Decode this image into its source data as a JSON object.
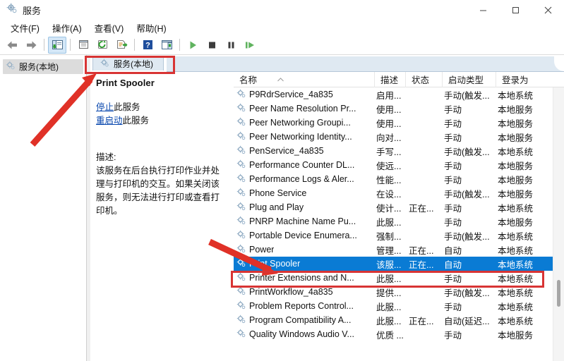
{
  "window": {
    "title": "服务",
    "icon": "services-gear-icon",
    "minimize_label": "—",
    "maximize_label": "▢",
    "close_label": "✕"
  },
  "menu": {
    "items": [
      {
        "label": "文件(F)",
        "name": "menu-file"
      },
      {
        "label": "操作(A)",
        "name": "menu-action"
      },
      {
        "label": "查看(V)",
        "name": "menu-view"
      },
      {
        "label": "帮助(H)",
        "name": "menu-help"
      }
    ]
  },
  "toolbar": {
    "buttons": [
      {
        "name": "back-icon",
        "title": "后退"
      },
      {
        "name": "forward-icon",
        "title": "前进"
      },
      {
        "name": "show-hide-console-tree-icon",
        "title": "显示/隐藏控制台树"
      },
      {
        "name": "properties-icon",
        "title": "属性"
      },
      {
        "name": "refresh-icon",
        "title": "刷新"
      },
      {
        "name": "export-list-icon",
        "title": "导出列表"
      },
      {
        "name": "help-icon",
        "title": "帮助"
      },
      {
        "name": "show-action-pane-icon",
        "title": "显示/隐藏操作窗格"
      },
      {
        "name": "start-service-icon",
        "title": "启动服务"
      },
      {
        "name": "stop-service-icon",
        "title": "停止服务"
      },
      {
        "name": "pause-service-icon",
        "title": "暂停服务"
      },
      {
        "name": "restart-service-icon",
        "title": "重启服务"
      }
    ]
  },
  "tree": {
    "root_label": "服务(本地)",
    "root_icon": "services-gear-icon"
  },
  "tab": {
    "label": "服务(本地)",
    "icon": "services-gear-icon"
  },
  "detail": {
    "service_name": "Print Spooler",
    "links": [
      {
        "link": "停止",
        "rest": "此服务",
        "name": "stop-service-link"
      },
      {
        "link": "重启动",
        "rest": "此服务",
        "name": "restart-service-link"
      }
    ],
    "description_heading": "描述:",
    "description_body": "该服务在后台执行打印作业并处理与打印机的交互。如果关闭该服务，则无法进行打印或查看打印机。"
  },
  "list": {
    "columns": [
      {
        "key": "name",
        "label": "名称",
        "sorted": "asc"
      },
      {
        "key": "description",
        "label": "描述"
      },
      {
        "key": "status",
        "label": "状态"
      },
      {
        "key": "startup",
        "label": "启动类型"
      },
      {
        "key": "logon",
        "label": "登录为"
      }
    ],
    "rows": [
      {
        "name": "P9RdrService_4a835",
        "description": "启用...",
        "status": "",
        "startup": "手动(触发...",
        "logon": "本地系统",
        "selected": false
      },
      {
        "name": "Peer Name Resolution Pr...",
        "description": "使用...",
        "status": "",
        "startup": "手动",
        "logon": "本地服务",
        "selected": false
      },
      {
        "name": "Peer Networking Groupi...",
        "description": "使用...",
        "status": "",
        "startup": "手动",
        "logon": "本地服务",
        "selected": false
      },
      {
        "name": "Peer Networking Identity...",
        "description": "向对...",
        "status": "",
        "startup": "手动",
        "logon": "本地服务",
        "selected": false
      },
      {
        "name": "PenService_4a835",
        "description": "手写...",
        "status": "",
        "startup": "手动(触发...",
        "logon": "本地系统",
        "selected": false
      },
      {
        "name": "Performance Counter DL...",
        "description": "使远...",
        "status": "",
        "startup": "手动",
        "logon": "本地服务",
        "selected": false
      },
      {
        "name": "Performance Logs & Aler...",
        "description": "性能...",
        "status": "",
        "startup": "手动",
        "logon": "本地服务",
        "selected": false
      },
      {
        "name": "Phone Service",
        "description": "在设...",
        "status": "",
        "startup": "手动(触发...",
        "logon": "本地服务",
        "selected": false
      },
      {
        "name": "Plug and Play",
        "description": "使计...",
        "status": "正在...",
        "startup": "手动",
        "logon": "本地系统",
        "selected": false
      },
      {
        "name": "PNRP Machine Name Pu...",
        "description": "此服...",
        "status": "",
        "startup": "手动",
        "logon": "本地服务",
        "selected": false
      },
      {
        "name": "Portable Device Enumera...",
        "description": "强制...",
        "status": "",
        "startup": "手动(触发...",
        "logon": "本地系统",
        "selected": false
      },
      {
        "name": "Power",
        "description": "管理...",
        "status": "正在...",
        "startup": "自动",
        "logon": "本地系统",
        "selected": false
      },
      {
        "name": "Print Spooler",
        "description": "该服...",
        "status": "正在...",
        "startup": "自动",
        "logon": "本地系统",
        "selected": true
      },
      {
        "name": "Printer Extensions and N...",
        "description": "此服...",
        "status": "",
        "startup": "手动",
        "logon": "本地系统",
        "selected": false
      },
      {
        "name": "PrintWorkflow_4a835",
        "description": "提供...",
        "status": "",
        "startup": "手动(触发...",
        "logon": "本地系统",
        "selected": false
      },
      {
        "name": "Problem Reports Control...",
        "description": "此服...",
        "status": "",
        "startup": "手动",
        "logon": "本地系统",
        "selected": false
      },
      {
        "name": "Program Compatibility A...",
        "description": "此服...",
        "status": "正在...",
        "startup": "自动(延迟...",
        "logon": "本地系统",
        "selected": false
      },
      {
        "name": "Quality Windows Audio V...",
        "description": "优质 ...",
        "status": "",
        "startup": "手动",
        "logon": "本地服务",
        "selected": false
      }
    ]
  },
  "annotations": {
    "accent_color": "#d83434",
    "arrow_color": "#e03127",
    "highlight_boxes": [
      {
        "name": "tab-highlight-box",
        "target": "服务(本地)"
      },
      {
        "name": "selected-row-highlight-box",
        "target": "Print Spooler"
      }
    ],
    "arrows": [
      {
        "name": "arrow-to-tab",
        "points_to": "服务(本地)"
      },
      {
        "name": "arrow-to-print-spooler-row",
        "points_to": "Print Spooler"
      }
    ]
  },
  "scrollbar": {
    "name": "list-vertical-scrollbar",
    "orientation": "vertical"
  }
}
